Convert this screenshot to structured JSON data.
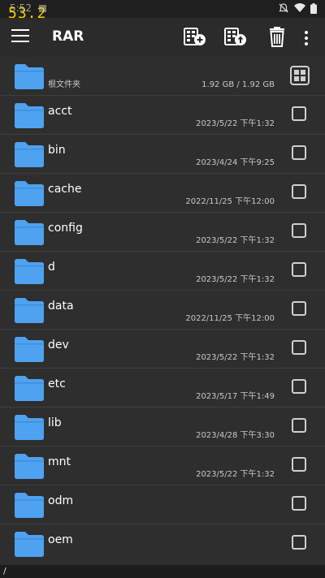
{
  "status_bar": {
    "time": "5:52",
    "fps_overlay": "53.2",
    "icons": [
      "notifications-off-icon",
      "wifi-icon",
      "battery-icon"
    ]
  },
  "app_bar": {
    "title": "RAR",
    "actions": [
      "add-to-archive-icon",
      "extract-archive-icon",
      "delete-icon",
      "more-options-icon"
    ]
  },
  "root_row": {
    "label": "根文件夹",
    "storage": "1.92 GB / 1.92 GB"
  },
  "folders": [
    {
      "name": "acct",
      "date": "2023/5/22 下午1:32"
    },
    {
      "name": "bin",
      "date": "2023/4/24 下午9:25"
    },
    {
      "name": "cache",
      "date": "2022/11/25 下午12:00"
    },
    {
      "name": "config",
      "date": "2023/5/22 下午1:32"
    },
    {
      "name": "d",
      "date": "2023/5/22 下午1:32"
    },
    {
      "name": "data",
      "date": "2022/11/25 下午12:00"
    },
    {
      "name": "dev",
      "date": "2023/5/22 下午1:32"
    },
    {
      "name": "etc",
      "date": "2023/5/17 下午1:49"
    },
    {
      "name": "lib",
      "date": "2023/4/28 下午3:30"
    },
    {
      "name": "mnt",
      "date": "2023/5/22 下午1:32"
    },
    {
      "name": "odm",
      "date": ""
    },
    {
      "name": "oem",
      "date": ""
    }
  ],
  "path_bar": {
    "path": "/"
  },
  "colors": {
    "background": "#2b2b2b",
    "folder_blue": "#4ea2f0",
    "fps_yellow": "#f0d000"
  }
}
